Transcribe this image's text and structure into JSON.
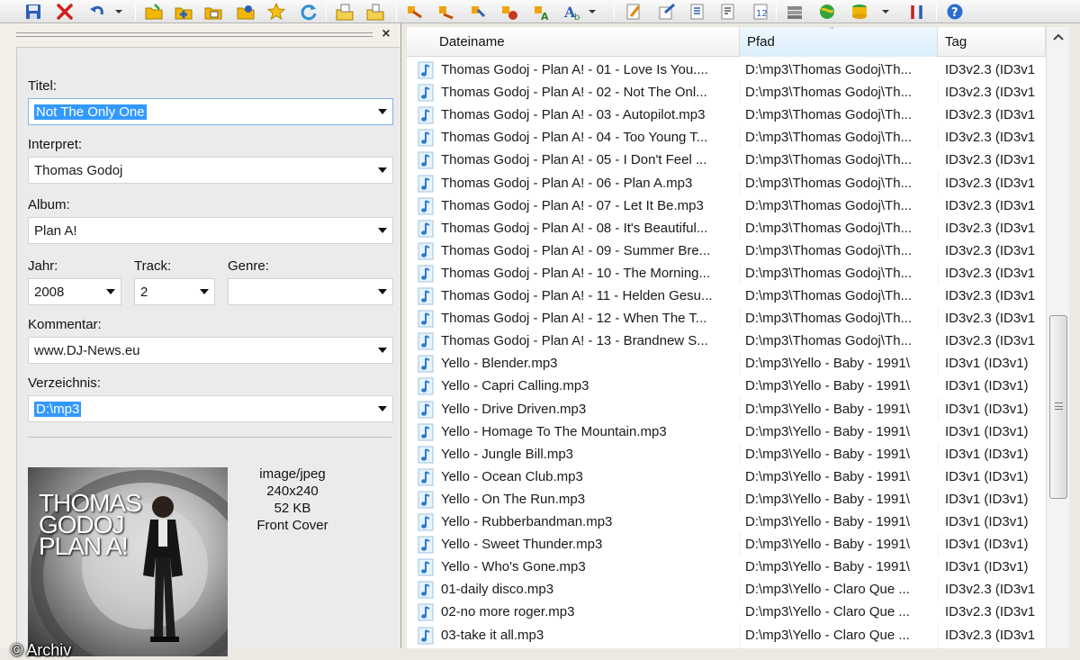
{
  "toolbar": {
    "buttons": [
      "save-icon",
      "delete-icon",
      "undo-icon",
      "open-folder-icon",
      "add-folder-icon",
      "folder-playlist-icon",
      "folder-image-icon",
      "favorites-star-icon",
      "refresh-icon",
      "folder-export-icon",
      "folder-lock-icon",
      "convert-tag-icon",
      "tag-to-filename-icon",
      "filename-to-tag-icon",
      "tag-from-web-icon",
      "text-tag-icon",
      "case-conversion-icon",
      "edit-icon",
      "export-icon",
      "list-export-icon",
      "text-export-icon",
      "numbering-icon",
      "tools-stack-icon",
      "freedb-globe-icon",
      "database-icon",
      "settings-tools-icon",
      "help-icon"
    ],
    "colors": {
      "accent": "#2b6cd4",
      "folder": "#f2b705"
    }
  },
  "tag_panel": {
    "title": {
      "label": "Titel:",
      "value": "Not The Only One"
    },
    "artist": {
      "label": "Interpret:",
      "value": "Thomas Godoj"
    },
    "album": {
      "label": "Album:",
      "value": "Plan A!"
    },
    "year": {
      "label": "Jahr:",
      "value": "2008"
    },
    "track": {
      "label": "Track:",
      "value": "2"
    },
    "genre": {
      "label": "Genre:",
      "value": ""
    },
    "comment": {
      "label": "Kommentar:",
      "value": "www.DJ-News.eu"
    },
    "directory": {
      "label": "Verzeichnis:",
      "value": "D:\\mp3"
    },
    "cover": {
      "mime": "image/jpeg",
      "dimensions": "240x240",
      "size": "52 KB",
      "type": "Front Cover"
    }
  },
  "file_list": {
    "columns": [
      "Dateiname",
      "Pfad",
      "Tag"
    ],
    "sorted_column": "Pfad",
    "rows": [
      {
        "name": "Thomas Godoj - Plan A! - 01 - Love Is You....",
        "path": "D:\\mp3\\Thomas Godoj\\Th...",
        "tag": "ID3v2.3 (ID3v1"
      },
      {
        "name": "Thomas Godoj - Plan A! - 02 - Not The Onl...",
        "path": "D:\\mp3\\Thomas Godoj\\Th...",
        "tag": "ID3v2.3 (ID3v1"
      },
      {
        "name": "Thomas Godoj - Plan A! - 03 - Autopilot.mp3",
        "path": "D:\\mp3\\Thomas Godoj\\Th...",
        "tag": "ID3v2.3 (ID3v1"
      },
      {
        "name": "Thomas Godoj - Plan A! - 04 - Too Young T...",
        "path": "D:\\mp3\\Thomas Godoj\\Th...",
        "tag": "ID3v2.3 (ID3v1"
      },
      {
        "name": "Thomas Godoj - Plan A! - 05 - I Don't Feel ...",
        "path": "D:\\mp3\\Thomas Godoj\\Th...",
        "tag": "ID3v2.3 (ID3v1"
      },
      {
        "name": "Thomas Godoj - Plan A! - 06 - Plan A.mp3",
        "path": "D:\\mp3\\Thomas Godoj\\Th...",
        "tag": "ID3v2.3 (ID3v1"
      },
      {
        "name": "Thomas Godoj - Plan A! - 07 - Let It Be.mp3",
        "path": "D:\\mp3\\Thomas Godoj\\Th...",
        "tag": "ID3v2.3 (ID3v1"
      },
      {
        "name": "Thomas Godoj - Plan A! - 08 - It's Beautiful...",
        "path": "D:\\mp3\\Thomas Godoj\\Th...",
        "tag": "ID3v2.3 (ID3v1"
      },
      {
        "name": "Thomas Godoj - Plan A! - 09 - Summer Bre...",
        "path": "D:\\mp3\\Thomas Godoj\\Th...",
        "tag": "ID3v2.3 (ID3v1"
      },
      {
        "name": "Thomas Godoj - Plan A! - 10 - The Morning...",
        "path": "D:\\mp3\\Thomas Godoj\\Th...",
        "tag": "ID3v2.3 (ID3v1"
      },
      {
        "name": "Thomas Godoj - Plan A! - 11 - Helden Gesu...",
        "path": "D:\\mp3\\Thomas Godoj\\Th...",
        "tag": "ID3v2.3 (ID3v1"
      },
      {
        "name": "Thomas Godoj - Plan A! - 12 - When The T...",
        "path": "D:\\mp3\\Thomas Godoj\\Th...",
        "tag": "ID3v2.3 (ID3v1"
      },
      {
        "name": "Thomas Godoj - Plan A! - 13 - Brandnew S...",
        "path": "D:\\mp3\\Thomas Godoj\\Th...",
        "tag": "ID3v2.3 (ID3v1"
      },
      {
        "name": "Yello - Blender.mp3",
        "path": "D:\\mp3\\Yello - Baby - 1991\\",
        "tag": "ID3v1 (ID3v1)"
      },
      {
        "name": "Yello - Capri Calling.mp3",
        "path": "D:\\mp3\\Yello - Baby - 1991\\",
        "tag": "ID3v1 (ID3v1)"
      },
      {
        "name": "Yello - Drive  Driven.mp3",
        "path": "D:\\mp3\\Yello - Baby - 1991\\",
        "tag": "ID3v1 (ID3v1)"
      },
      {
        "name": "Yello - Homage To The Mountain.mp3",
        "path": "D:\\mp3\\Yello - Baby - 1991\\",
        "tag": "ID3v1 (ID3v1)"
      },
      {
        "name": "Yello - Jungle Bill.mp3",
        "path": "D:\\mp3\\Yello - Baby - 1991\\",
        "tag": "ID3v1 (ID3v1)"
      },
      {
        "name": "Yello - Ocean Club.mp3",
        "path": "D:\\mp3\\Yello - Baby - 1991\\",
        "tag": "ID3v1 (ID3v1)"
      },
      {
        "name": "Yello - On The Run.mp3",
        "path": "D:\\mp3\\Yello - Baby - 1991\\",
        "tag": "ID3v1 (ID3v1)"
      },
      {
        "name": "Yello - Rubberbandman.mp3",
        "path": "D:\\mp3\\Yello - Baby - 1991\\",
        "tag": "ID3v1 (ID3v1)"
      },
      {
        "name": "Yello - Sweet Thunder.mp3",
        "path": "D:\\mp3\\Yello - Baby - 1991\\",
        "tag": "ID3v1 (ID3v1)"
      },
      {
        "name": "Yello - Who's Gone.mp3",
        "path": "D:\\mp3\\Yello - Baby - 1991\\",
        "tag": "ID3v1 (ID3v1)"
      },
      {
        "name": "01-daily disco.mp3",
        "path": "D:\\mp3\\Yello - Claro Que ...",
        "tag": "ID3v2.3 (ID3v1"
      },
      {
        "name": "02-no more roger.mp3",
        "path": "D:\\mp3\\Yello - Claro Que ...",
        "tag": "ID3v2.3 (ID3v1"
      },
      {
        "name": "03-take it all.mp3",
        "path": "D:\\mp3\\Yello - Claro Que ...",
        "tag": "ID3v2.3 (ID3v1"
      }
    ]
  },
  "watermark": "© Archiv"
}
